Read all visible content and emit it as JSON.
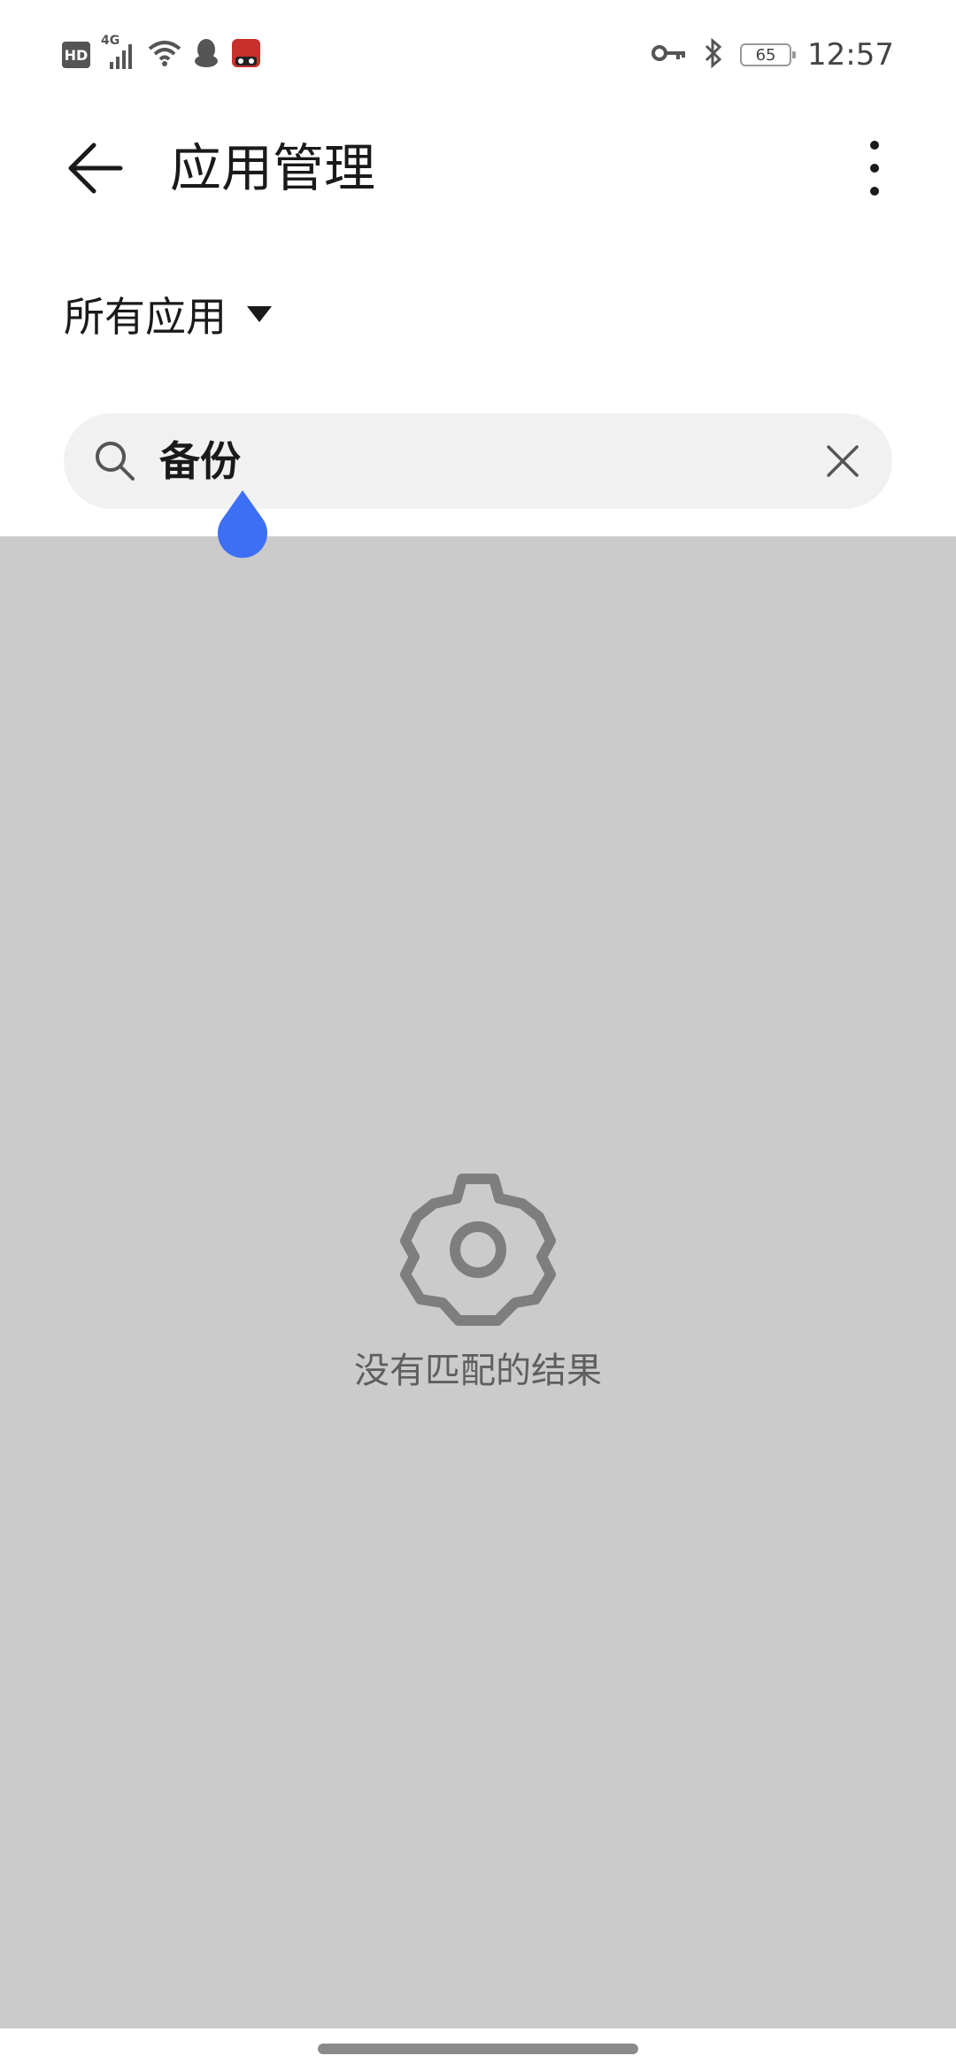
{
  "status_bar": {
    "hd_label": "HD",
    "network_label": "4G",
    "battery_level": "65",
    "time": "12:57"
  },
  "app_bar": {
    "title": "应用管理"
  },
  "filter": {
    "label": "所有应用"
  },
  "search": {
    "value": "备份"
  },
  "empty_state": {
    "message": "没有匹配的结果"
  },
  "colors": {
    "overlay": "#cbcbcb",
    "accent": "#3d6ff5",
    "empty_icon": "#7e7e7e"
  }
}
